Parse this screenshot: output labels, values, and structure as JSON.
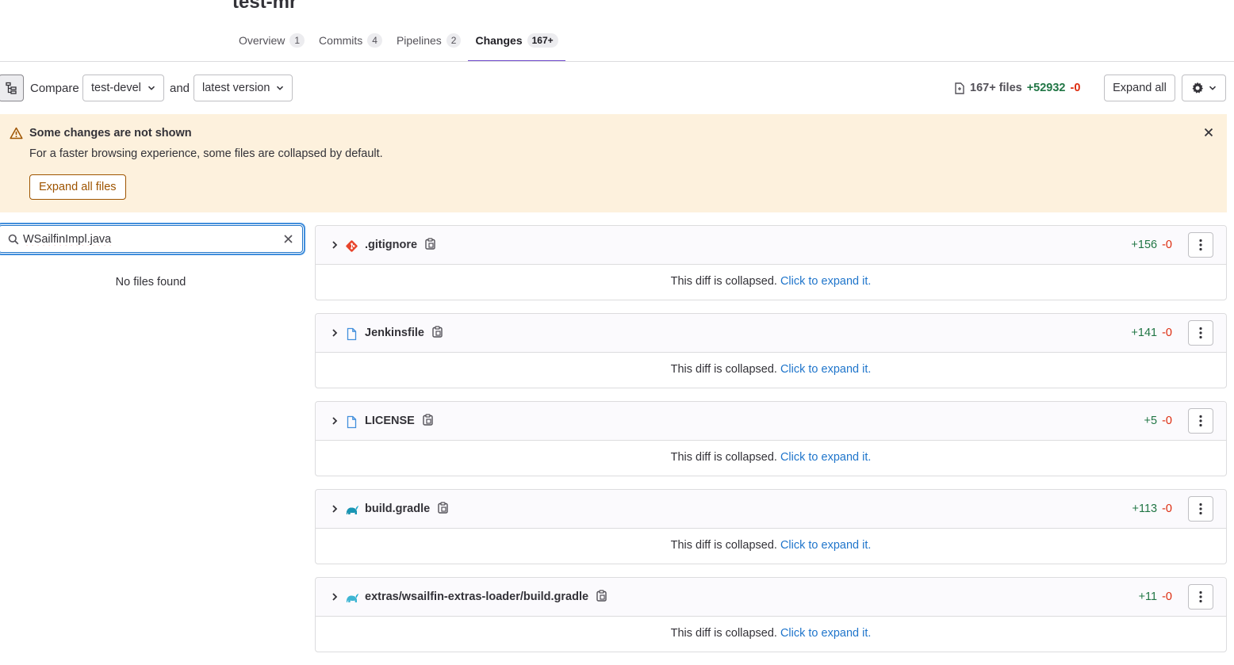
{
  "page": {
    "title": "test-mr"
  },
  "tabs": [
    {
      "label": "Overview",
      "count": "1"
    },
    {
      "label": "Commits",
      "count": "4"
    },
    {
      "label": "Pipelines",
      "count": "2"
    },
    {
      "label": "Changes",
      "count": "167+"
    }
  ],
  "toolbar": {
    "compare_label": "Compare",
    "source_branch": "test-devel",
    "and_label": "and",
    "target_version": "latest version",
    "files_count": "167+ files",
    "additions": "+52932",
    "deletions": "-0",
    "expand_all_label": "Expand all"
  },
  "alert": {
    "title": "Some changes are not shown",
    "body": "For a faster browsing experience, some files are collapsed by default.",
    "button_label": "Expand all files"
  },
  "file_tree": {
    "search_value": "WSailfinImpl.java",
    "empty_message": "No files found"
  },
  "files": [
    {
      "name": ".gitignore",
      "icon": "git-icon",
      "additions": "+156",
      "deletions": "-0"
    },
    {
      "name": "Jenkinsfile",
      "icon": "file-icon",
      "additions": "+141",
      "deletions": "-0"
    },
    {
      "name": "LICENSE",
      "icon": "file-icon",
      "additions": "+5",
      "deletions": "-0"
    },
    {
      "name": "build.gradle",
      "icon": "gradle-icon",
      "additions": "+113",
      "deletions": "-0"
    },
    {
      "name": "extras/wsailfin-extras-loader/build.gradle",
      "icon": "gradle-icon",
      "additions": "+11",
      "deletions": "-0"
    }
  ],
  "collapsed_text": "This diff is collapsed.",
  "expand_link": "Click to expand it.",
  "colors": {
    "accent": "#6e49cb",
    "added": "#217645",
    "removed": "#dd2b0e",
    "link": "#1f75cb",
    "warning_bg": "#fdf1dd",
    "warning_text": "#9e5400"
  }
}
